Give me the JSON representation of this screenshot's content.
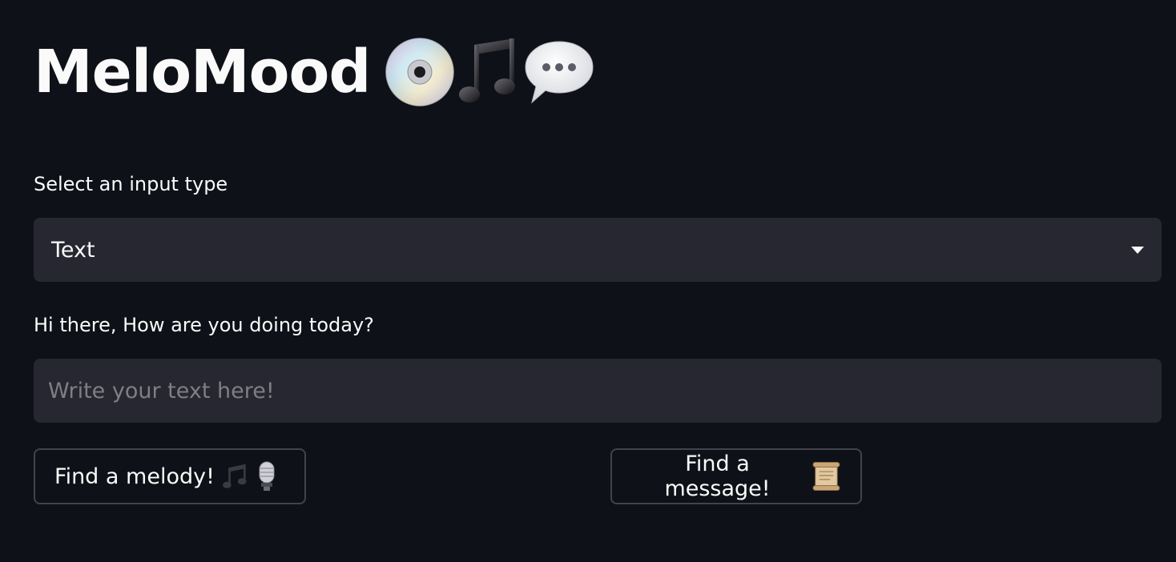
{
  "header": {
    "title": "MeloMood",
    "title_icons": [
      "cd-icon",
      "musical-notes-icon",
      "speech-bubble-icon"
    ]
  },
  "input_type": {
    "label": "Select an input type",
    "selected": "Text"
  },
  "text_entry": {
    "label": "Hi there, How are you doing today?",
    "placeholder": "Write your text here!",
    "value": ""
  },
  "buttons": {
    "melody": {
      "label": "Find a melody!",
      "icons": [
        "notes-icon",
        "microphone-icon"
      ]
    },
    "message": {
      "label": "Find a message!",
      "icons": [
        "scroll-icon"
      ]
    }
  },
  "colors": {
    "background": "#0e1117",
    "input_background": "#262730",
    "text": "#fafafa",
    "placeholder": "#7e7f86",
    "button_border": "#42434b"
  }
}
